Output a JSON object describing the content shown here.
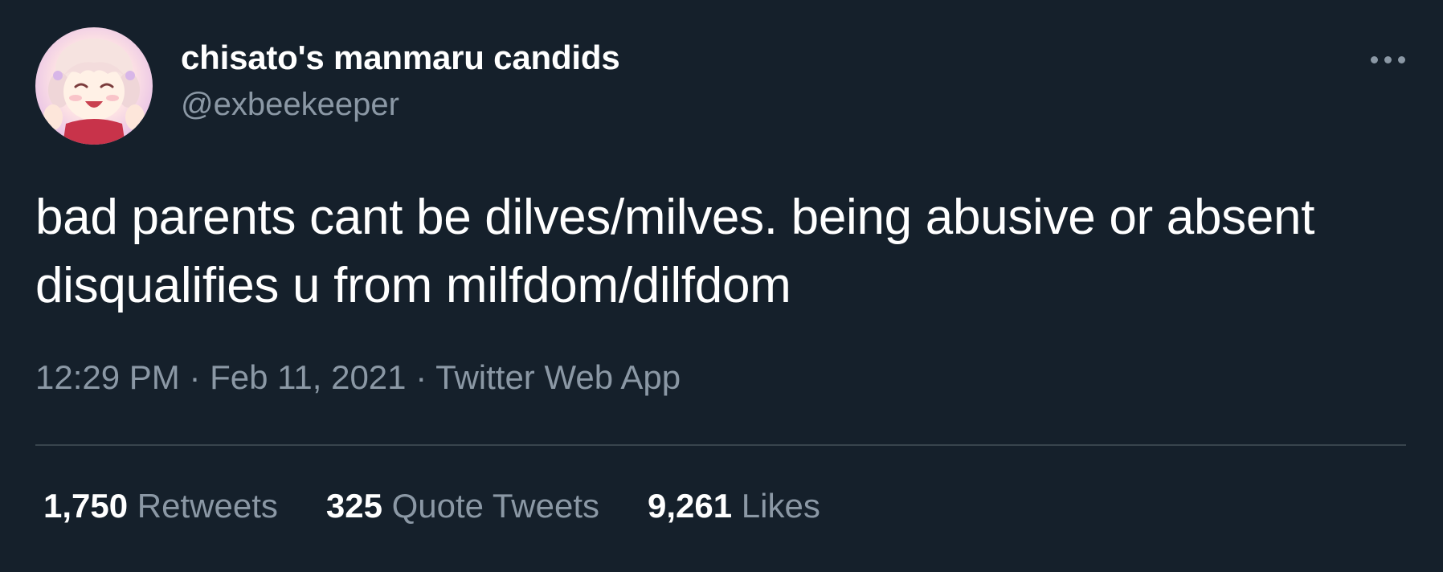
{
  "user": {
    "display_name": "chisato's manmaru candids",
    "handle": "@exbeekeeper",
    "avatar_icon": "anime-avatar-icon"
  },
  "more_icon": "more-horizontal-icon",
  "tweet": {
    "text": "bad parents cant be dilves/milves. being abusive or absent disqualifies u from milfdom/dilfdom"
  },
  "meta": {
    "time": "12:29 PM",
    "sep1": " · ",
    "date": "Feb 11, 2021",
    "sep2": " · ",
    "source": "Twitter Web App"
  },
  "stats": {
    "retweets": {
      "count": "1,750",
      "label": "Retweets"
    },
    "quotes": {
      "count": "325",
      "label": "Quote Tweets"
    },
    "likes": {
      "count": "9,261",
      "label": "Likes"
    }
  },
  "colors": {
    "background": "#15202b",
    "primary_text": "#ffffff",
    "secondary_text": "#8b98a5",
    "divider": "#38444d"
  }
}
